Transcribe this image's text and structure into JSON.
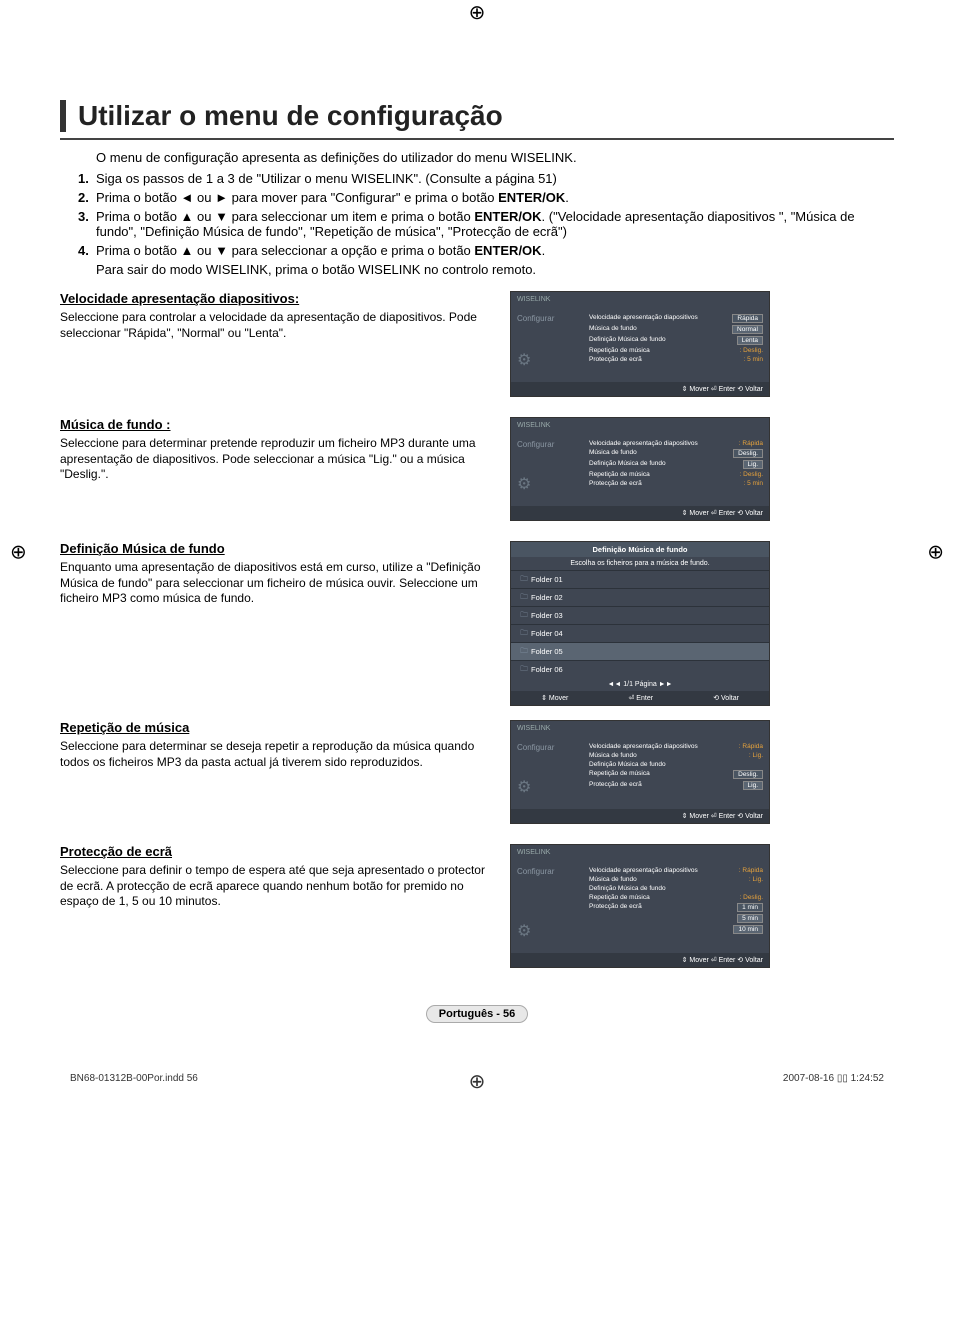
{
  "title": "Utilizar o menu de configuração",
  "intro": "O menu de configuração apresenta as definições do utilizador do menu WISELINK.",
  "steps": [
    {
      "num": "1.",
      "text": "Siga os passos de 1 a 3 de \"Utilizar o menu WISELINK\". (Consulte a página 51)"
    },
    {
      "num": "2.",
      "text": "Prima o botão ◄ ou ► para mover para \"Configurar\" e prima o botão ",
      "bold": "ENTER/OK",
      "tail": "."
    },
    {
      "num": "3.",
      "text": "Prima o botão ▲ ou ▼ para seleccionar um item e prima o botão ",
      "bold": "ENTER/OK",
      "tail": ". (\"Velocidade apresentação diapositivos \", \"Música de fundo\", \"Definição Música de fundo\", \"Repetição de música\", \"Protecção de ecrã\")"
    },
    {
      "num": "4.",
      "text": "Prima o botão ▲ ou ▼ para seleccionar a opção e prima o botão ",
      "bold": "ENTER/OK",
      "tail": "."
    }
  ],
  "extra": "Para sair do modo WISELINK, prima o botão ",
  "extraBold": "WISELINK",
  "extraTail": " no controlo remoto.",
  "sections": [
    {
      "title": "Velocidade apresentação diapositivos:",
      "text": "Seleccione para controlar a velocidade da apresentação de diapositivos. Pode seleccionar \"Rápida\", \"Normal\" ou \"Lenta\"."
    },
    {
      "title": "Música de fundo :",
      "text": "Seleccione para determinar pretende reproduzir um ficheiro MP3 durante uma apresentação de diapositivos. Pode seleccionar a música \"Lig.\" ou a música \"Deslig.\"."
    },
    {
      "title": "Definição Música de fundo",
      "text": "Enquanto uma apresentação de diapositivos está em curso, utilize a \"Definição Música de fundo\" para seleccionar um ficheiro de música ouvir. Seleccione um ficheiro MP3 como música de fundo."
    },
    {
      "title": "Repetição de música",
      "text": "Seleccione para determinar se deseja repetir a reprodução da música quando todos os ficheiros MP3 da pasta actual já tiverem sido reproduzidos."
    },
    {
      "title": "Protecção de ecrã",
      "text": "Seleccione para definir o tempo de espera até que seja apresentado o protector de ecrã. A protecção de ecrã aparece quando nenhum botão for premido no espaço de 1, 5 ou 10 minutos."
    }
  ],
  "screen": {
    "brand": "WISELINK",
    "side": "Configurar",
    "rows": [
      {
        "lab": "Velocidade apresentação diapositivos",
        "val": ": Rápida"
      },
      {
        "lab": "Música de fundo",
        "val": ": Lig."
      },
      {
        "lab": "Definição Música de fundo",
        "val": ""
      },
      {
        "lab": "Repetição de música",
        "val": ": Deslig."
      },
      {
        "lab": "Protecção de ecrã",
        "val": ": 5 min"
      }
    ],
    "opts1": [
      "Rápida",
      "Normal",
      "Lenta"
    ],
    "opts2": [
      "Deslig.",
      "Lig."
    ],
    "opts4": [
      "Deslig.",
      "Lig."
    ],
    "opts5": [
      "1 min",
      "5 min",
      "10 min"
    ],
    "nav": "⇕ Mover   ⏎ Enter   ⟲ Voltar"
  },
  "folder": {
    "title": "Definição Música de fundo",
    "sub": "Escolha os ficheiros para a música de fundo.",
    "items": [
      "Folder 01",
      "Folder 02",
      "Folder 03",
      "Folder 04",
      "Folder 05",
      "Folder 06"
    ],
    "pager": "◄◄ 1/1 Página ►►",
    "nav": [
      "⇕ Mover",
      "⏎ Enter",
      "⟲ Voltar"
    ]
  },
  "pageLabel": "Português - 56",
  "footer": {
    "left": "BN68-01312B-00Por.indd   56",
    "right": "2007-08-16   ▯▯ 1:24:52"
  }
}
